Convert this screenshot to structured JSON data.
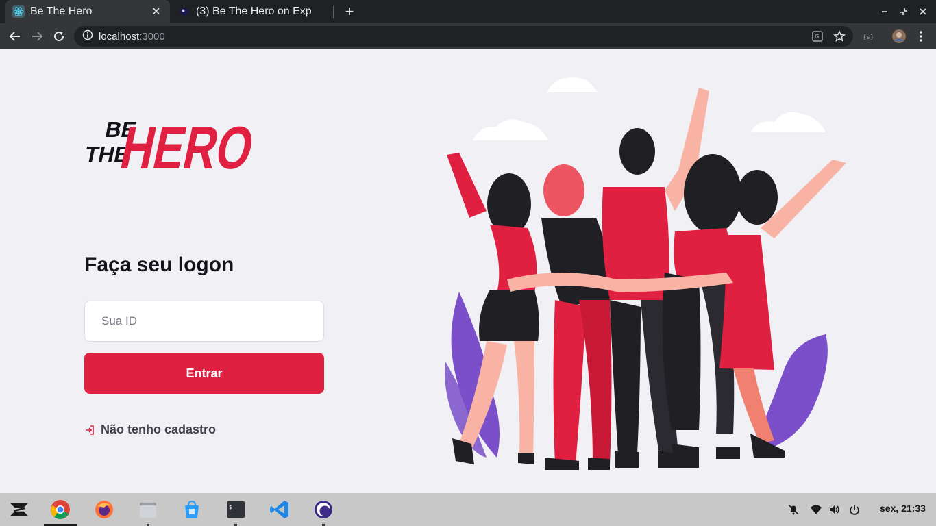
{
  "browser": {
    "tabs": [
      {
        "title": "Be The Hero",
        "active": true,
        "icon": "react-icon"
      },
      {
        "title": "(3) Be The Hero on Exp",
        "active": false,
        "icon": "expo-icon"
      }
    ],
    "new_tab": "+",
    "address": {
      "host": "localhost",
      "port": ":3000"
    }
  },
  "login": {
    "logo_alt": "Be The Hero",
    "heading": "Faça seu logon",
    "id_placeholder": "Sua ID",
    "id_value": "",
    "submit_label": "Entrar",
    "register_link": "Não tenho cadastro"
  },
  "colors": {
    "brand": "#e02041",
    "background": "#f0f0f5",
    "text_dark": "#13131a",
    "text_muted": "#41414d"
  },
  "taskbar": {
    "apps": [
      "zorin-menu-icon",
      "chrome-icon",
      "firefox-icon",
      "files-icon",
      "software-store-icon",
      "terminal-icon",
      "vscode-icon",
      "expo-app-icon"
    ],
    "clock": "sex, 21:33"
  }
}
